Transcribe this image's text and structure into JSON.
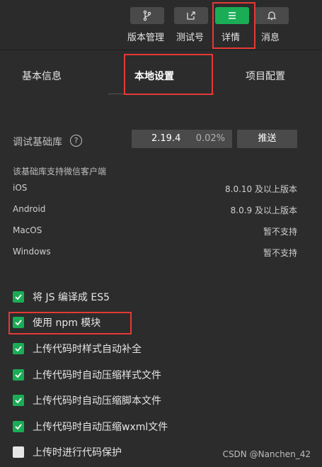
{
  "toolbar": {
    "items": [
      {
        "label": "版本管理",
        "icon": "branch-icon"
      },
      {
        "label": "测试号",
        "icon": "external-link-icon"
      },
      {
        "label": "详情",
        "icon": "menu-icon"
      },
      {
        "label": "消息",
        "icon": "bell-icon"
      }
    ],
    "active_color": "#1aad56"
  },
  "tabs": [
    "基本信息",
    "本地设置",
    "项目配置"
  ],
  "active_tab": "本地设置",
  "debug_lib": {
    "label": "调试基础库",
    "help": "?",
    "version": "2.19.4",
    "percent": "0.02%",
    "push_label": "推送"
  },
  "support": {
    "title": "该基础库支持微信客户端",
    "rows": [
      {
        "platform": "iOS",
        "value": "8.0.10 及以上版本"
      },
      {
        "platform": "Android",
        "value": "8.0.9 及以上版本"
      },
      {
        "platform": "MacOS",
        "value": "暂不支持"
      },
      {
        "platform": "Windows",
        "value": "暂不支持"
      }
    ]
  },
  "options": [
    {
      "label": "将 JS 编译成 ES5",
      "checked": true
    },
    {
      "label": "使用 npm 模块",
      "checked": true
    },
    {
      "label": "上传代码时样式自动补全",
      "checked": true
    },
    {
      "label": "上传代码时自动压缩样式文件",
      "checked": true
    },
    {
      "label": "上传代码时自动压缩脚本文件",
      "checked": true
    },
    {
      "label": "上传代码时自动压缩wxml文件",
      "checked": true
    },
    {
      "label": "上传时进行代码保护",
      "checked": false
    }
  ],
  "watermark": "CSDN @Nanchen_42"
}
